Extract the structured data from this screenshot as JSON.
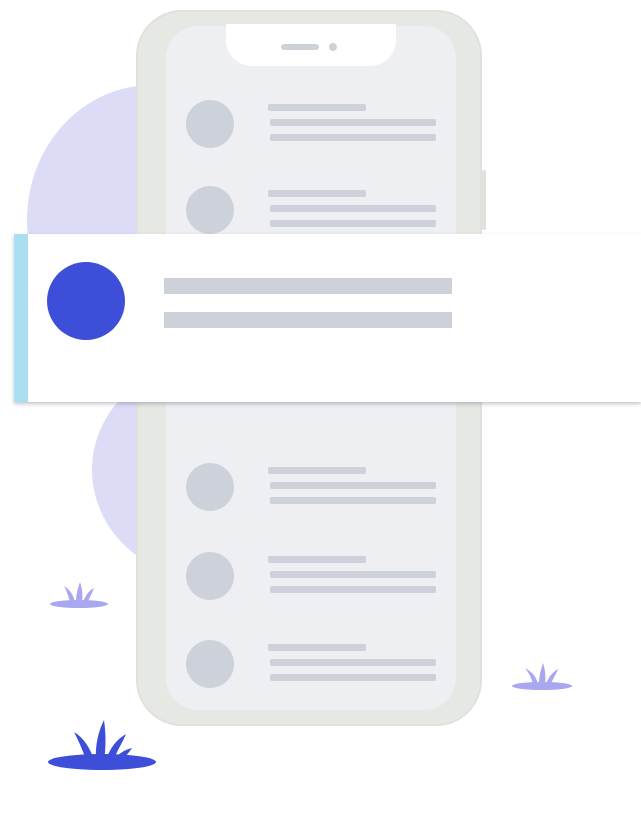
{
  "illustration": {
    "subject": "phone-message-list",
    "colors": {
      "background": "#ffffff",
      "phone_frame": "#e6e8e4",
      "phone_screen": "#edeff2",
      "placeholder": "#cdd1da",
      "highlight_avatar": "#3d4fd8",
      "card_accent": "#a9dff0",
      "blob": "#dcdcf7",
      "plant_dark": "#3d4fd8",
      "plant_light": "#a9a7ef"
    },
    "list_rows_above_card": 2,
    "list_rows_below_card": 3,
    "highlighted_item": {
      "avatar_icon": "contact-avatar-icon",
      "text_lines": 2
    }
  }
}
